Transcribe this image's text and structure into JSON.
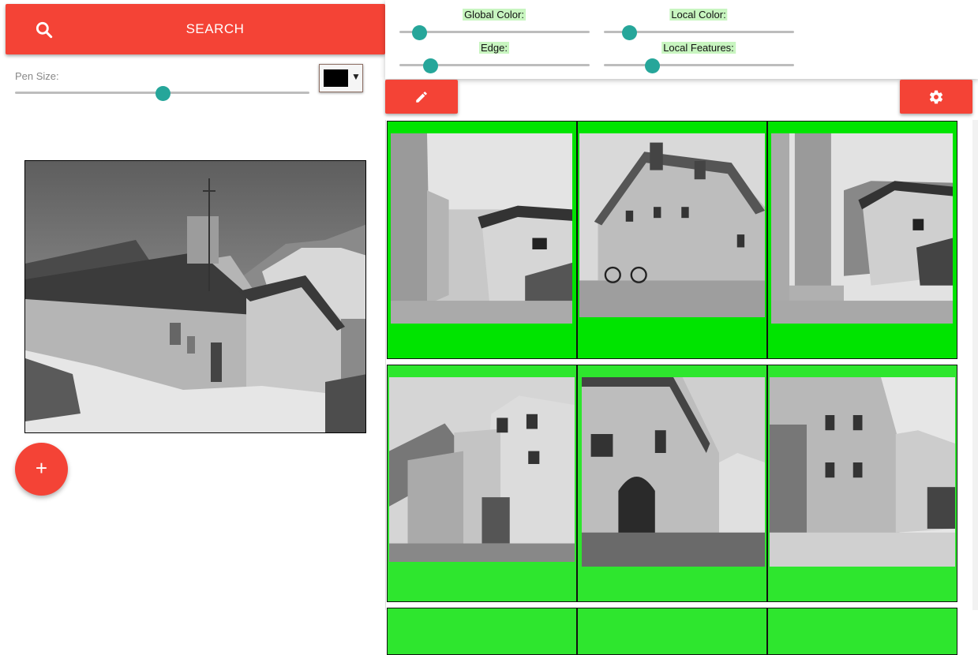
{
  "search": {
    "label": "SEARCH",
    "icon": "search-icon"
  },
  "pen": {
    "label": "Pen Size:",
    "value": 0.5,
    "color": "#000000"
  },
  "weights": [
    {
      "label": "Global Color:",
      "value": 0.1
    },
    {
      "label": "Local Color:",
      "value": 0.13
    },
    {
      "label": "Edge:",
      "value": 0.16
    },
    {
      "label": "Local Features:",
      "value": 0.25
    }
  ],
  "toolbar": {
    "edit_icon": "pencil-icon",
    "settings_icon": "gear-icon"
  },
  "fab": {
    "label": "+"
  },
  "colors": {
    "accent": "#f44336",
    "thumb": "#26a69a",
    "result_bg": "#00e400",
    "result_bg_alt": "#2ee62e"
  },
  "results_count_visible": 6
}
